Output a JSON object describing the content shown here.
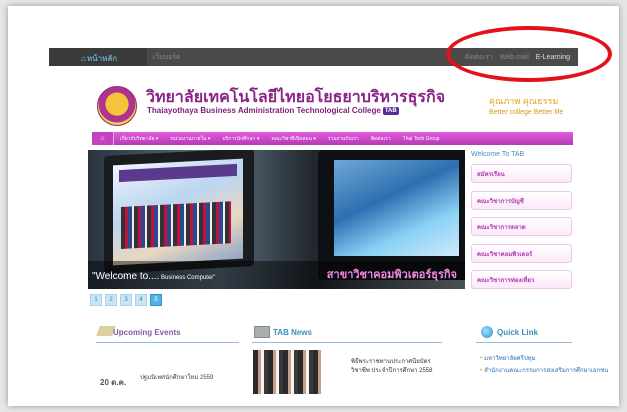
{
  "topbar": {
    "home_label": "หน้าหลัก",
    "other_label": "เว็บบอร์ด",
    "right_links": [
      "ติดต่อเรา",
      "Web mail",
      "E-Learning"
    ]
  },
  "header": {
    "title_th": "วิทยาลัยเทคโนโลยีไทยอโยธยาบริหารธุรกิจ",
    "title_en": "Thaiayothaya Business Administration Technological College",
    "badge": "TAB",
    "slogan_th": "คุณภาพ คุณธรรม",
    "slogan_en": "Better college Better life"
  },
  "nav": {
    "items": [
      "เกี่ยวกับวิทยาลัย ▾",
      "หน่วยงานภายใน ▾",
      "บริการนักศึกษา ▾",
      "คณะวิชาที่เปิดสอน ▾",
      "ร่วมงานกับเรา",
      "ติดต่อเรา",
      "Thai Tech Group"
    ]
  },
  "slider": {
    "caption_welcome": "\"Welcome to....",
    "caption_small": " Business Computer\"",
    "caption_thai": "สาขาวิชาคอมพิวเตอร์ธุรกิจ"
  },
  "pager": [
    "1",
    "2",
    "3",
    "4",
    "5"
  ],
  "sidebar": {
    "welcome": "Welcome To TAB",
    "buttons": [
      "สมัครเรียน",
      "คณะวิชาการบัญชี",
      "คณะวิชาการตลาด",
      "คณะวิชาคอมพิวเตอร์",
      "คณะวิชาการท่องเที่ยว"
    ]
  },
  "upcoming": {
    "title": "Upcoming Events",
    "date": "20 ต.ค.",
    "item": "ปฐมนิเทศนักศึกษาใหม่ 2559"
  },
  "tab_news": {
    "title": "TAB  News",
    "text": "พิธีพระราชทานประกาศนียบัตรวิชาชีพ ประจำปีการศึกษา 2558"
  },
  "quick_link": {
    "title": "Quick Link",
    "links": [
      "มหาวิทยาลัยศรีปทุม",
      "สำนักงานคณะกรรมการส่งเสริมการศึกษาเอกชน"
    ]
  },
  "colors": {
    "brand_purple": "#b43ab3",
    "accent_blue": "#3c8fbf",
    "highlight_red": "#e3121a"
  }
}
